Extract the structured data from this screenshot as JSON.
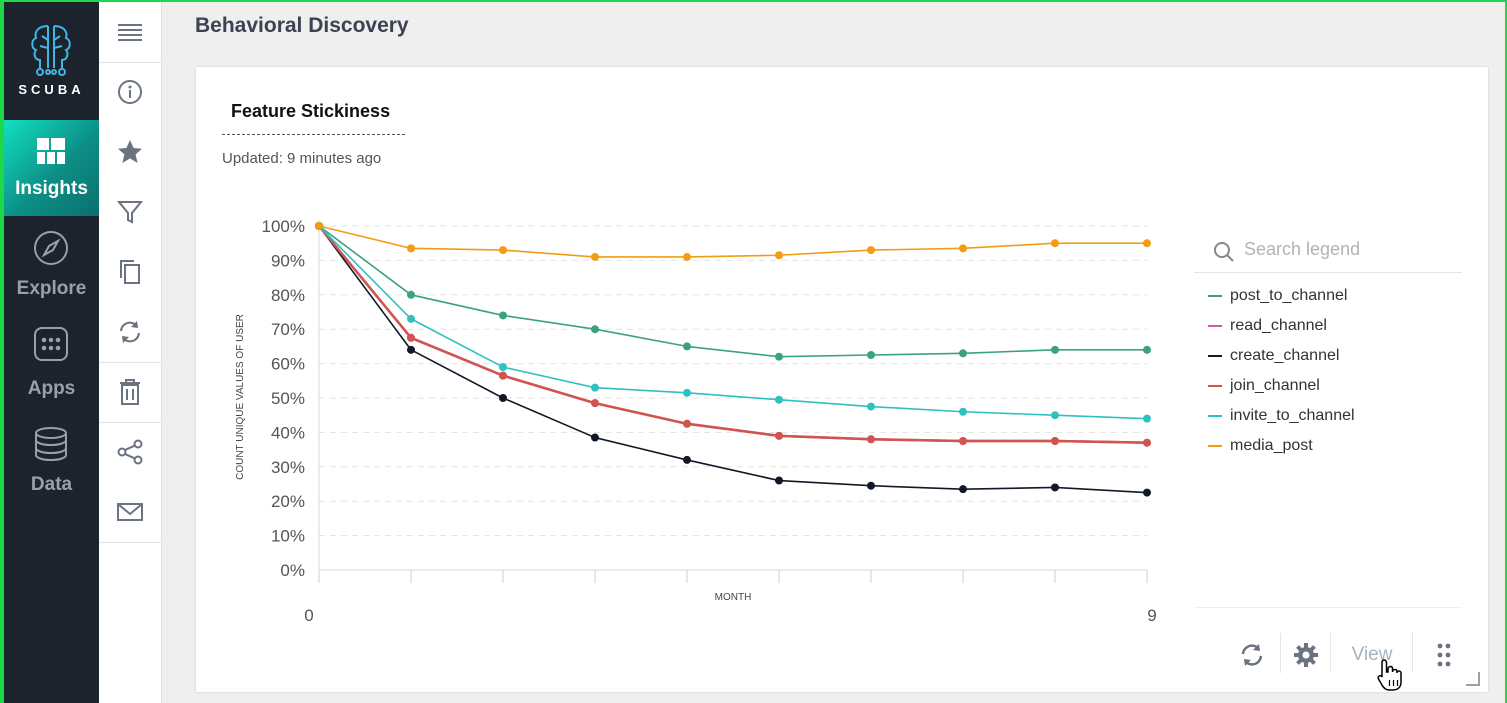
{
  "app": {
    "logo_text": "SCUBA",
    "page_title": "Behavioral Discovery"
  },
  "nav": {
    "items": [
      {
        "label": "Insights",
        "icon": "insights-grid-icon",
        "active": true
      },
      {
        "label": "Explore",
        "icon": "compass-icon",
        "active": false
      },
      {
        "label": "Apps",
        "icon": "apps-icon",
        "active": false
      },
      {
        "label": "Data",
        "icon": "database-icon",
        "active": false
      }
    ]
  },
  "toolbar": {
    "icons": [
      "menu-icon",
      "info-icon",
      "star-icon",
      "filter-icon",
      "copy-icon",
      "refresh-icon",
      "trash-icon",
      "share-icon",
      "mail-icon"
    ]
  },
  "card": {
    "title": "Feature Stickiness",
    "updated": "Updated: 9 minutes ago",
    "footer": {
      "view_label": "View"
    }
  },
  "legend": {
    "search_placeholder": "Search legend"
  },
  "colors": {
    "accent": "#12c9b0",
    "nav_bg": "#1c232d"
  },
  "chart_data": {
    "type": "line",
    "title": "Feature Stickiness",
    "xlabel": "MONTH",
    "ylabel": "COUNT UNIQUE VALUES OF USER",
    "x": [
      0,
      1,
      2,
      3,
      4,
      5,
      6,
      7,
      8,
      9
    ],
    "x_tick_labels": [
      "0",
      "9"
    ],
    "y_tick_labels": [
      "100%",
      "90%",
      "80%",
      "70%",
      "60%",
      "50%",
      "40%",
      "30%",
      "20%",
      "10%",
      "0%"
    ],
    "ylim": [
      0,
      100
    ],
    "grid": true,
    "legend_position": "right",
    "series": [
      {
        "name": "post_to_channel",
        "color": "#3aa283",
        "values": [
          100,
          80,
          74,
          70,
          65,
          62,
          62.5,
          63,
          64,
          64
        ]
      },
      {
        "name": "read_channel",
        "color": "#d957a7",
        "values": [
          100,
          67.5,
          56.5,
          48.5,
          42.5,
          39,
          38,
          37.5,
          37.5,
          37
        ]
      },
      {
        "name": "create_channel",
        "color": "#111827",
        "values": [
          100,
          64,
          50,
          38.5,
          32,
          26,
          24.5,
          23.5,
          24,
          22.5
        ]
      },
      {
        "name": "join_channel",
        "color": "#d0554f",
        "values": [
          100,
          67.5,
          56.5,
          48.5,
          42.5,
          39,
          38,
          37.5,
          37.5,
          37
        ]
      },
      {
        "name": "invite_to_channel",
        "color": "#2fc0c0",
        "values": [
          100,
          73,
          59,
          53,
          51.5,
          49.5,
          47.5,
          46,
          45,
          44
        ]
      },
      {
        "name": "media_post",
        "color": "#f39c12",
        "values": [
          100,
          93.5,
          93,
          91,
          91,
          91.5,
          93,
          93.5,
          95,
          95
        ]
      }
    ]
  }
}
